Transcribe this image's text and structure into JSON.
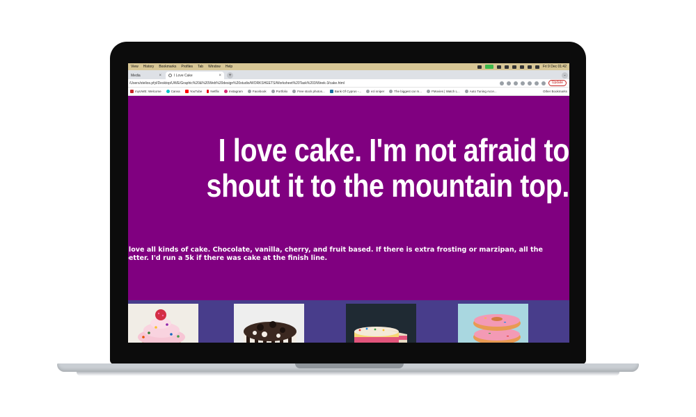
{
  "menubar": {
    "items": [
      "View",
      "History",
      "Bookmarks",
      "Profiles",
      "Tab",
      "Window",
      "Help"
    ],
    "clock": "Fri 9 Dec  01:42"
  },
  "tabs": {
    "inactive_label": "Media",
    "active_label": "I Love Cake",
    "close_glyph": "×",
    "new_tab_glyph": "+",
    "tab_menu_glyph": "⌄"
  },
  "address": {
    "url": "/Users/stelios.pfyl/Desktop/UWE/Graphic%20&%20Web%20design%20studio/WORKSHEETS/Worksheet%20Task%203/Week-3/cake.html",
    "update_label": "Update"
  },
  "bookmarks": [
    {
      "label": "myUWE: Welcome",
      "color": "#c62828"
    },
    {
      "label": "Canva",
      "color": "#00c4cc"
    },
    {
      "label": "YouTube",
      "color": "#ff0000"
    },
    {
      "label": "Netflix",
      "color": "#e50914"
    },
    {
      "label": "Instagram",
      "color": "#d62976"
    },
    {
      "label": "Facebook",
      "color": "#9aa0a6"
    },
    {
      "label": "Portfolio",
      "color": "#9aa0a6"
    },
    {
      "label": "Free stock photos...",
      "color": "#9aa0a6"
    },
    {
      "label": "Bank Of Cyprus -...",
      "color": "#1a6fa0"
    },
    {
      "label": "ezi sniper",
      "color": "#9aa0a6"
    },
    {
      "label": "The biggest car m...",
      "color": "#9aa0a6"
    },
    {
      "label": "FMovies | Watch L...",
      "color": "#9aa0a6"
    },
    {
      "label": "Auto Tuning Acce...",
      "color": "#9aa0a6"
    }
  ],
  "bookmarks_other": "Other Bookmarks",
  "page": {
    "headline": "I love cake. I'm not afraid to\nshout it to the mountain top.",
    "body": "I love all kinds of cake. Chocolate, vanilla, cherry, and fruit based. If there is extra frosting or marzipan, all the better. I'd run a 5k if there was cake at the finish line.",
    "background_color": "#800080",
    "gallery_color": "#483d8b"
  },
  "gallery": [
    {
      "subject": "cupcake with pink frosting and raspberry"
    },
    {
      "subject": "chocolate oreo cookie cake in hand"
    },
    {
      "subject": "layered sprinkle cake on blue stand"
    },
    {
      "subject": "stack of pink sprinkle donuts"
    }
  ]
}
